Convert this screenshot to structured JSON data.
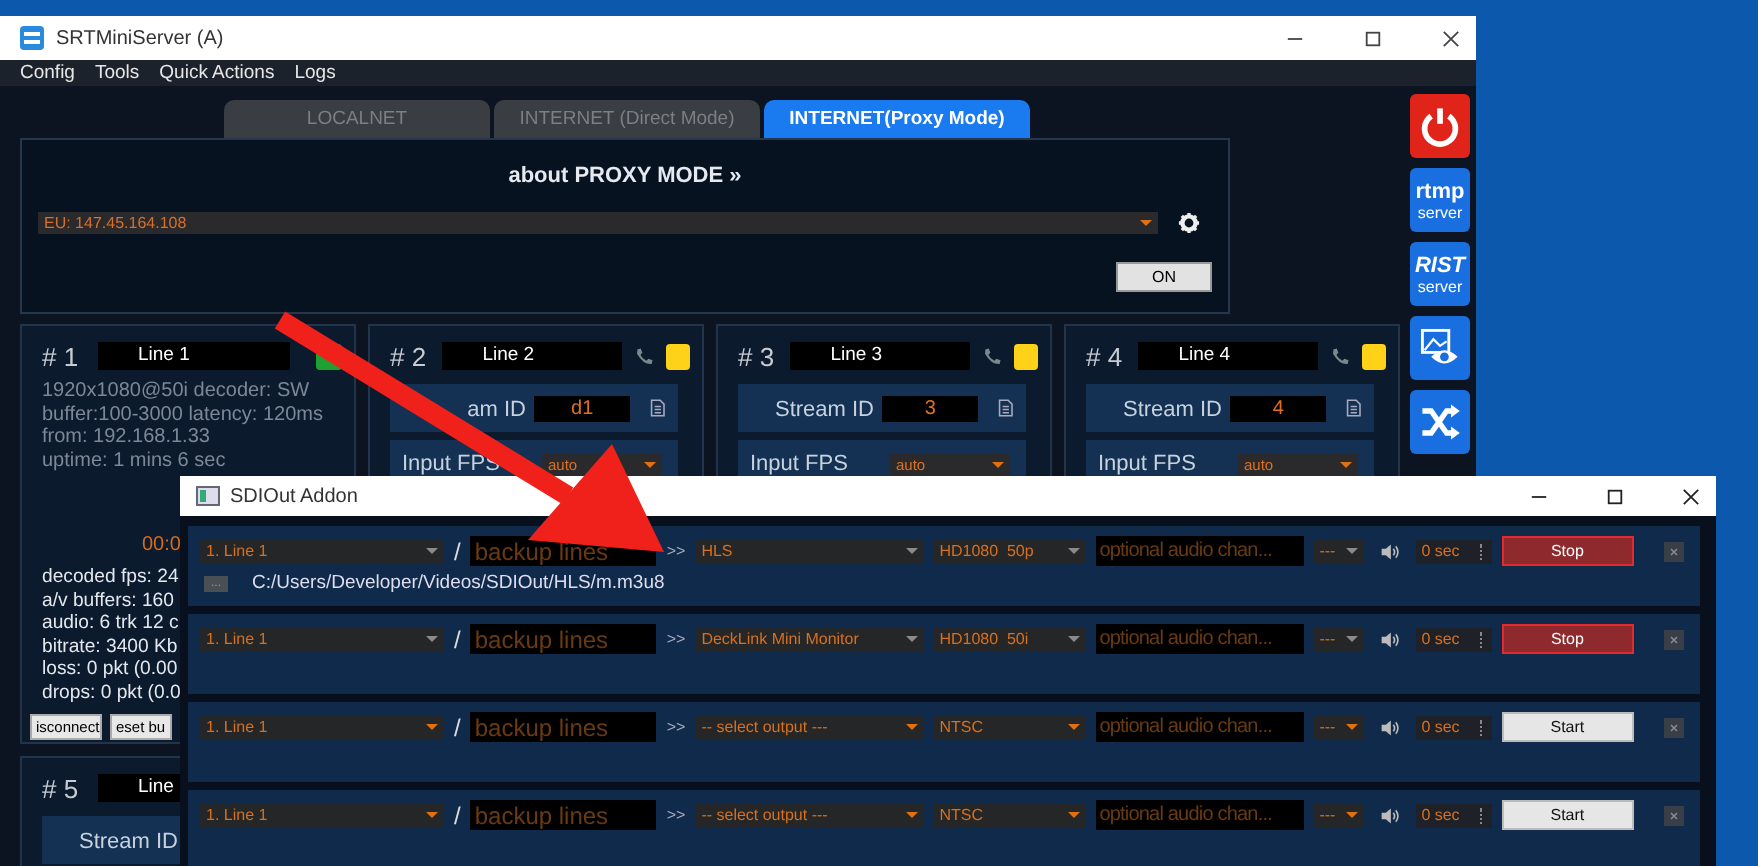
{
  "window": {
    "title": "SRTMiniServer (A)"
  },
  "menu": [
    "Config",
    "Tools",
    "Quick Actions",
    "Logs"
  ],
  "tabs": [
    {
      "label": "LOCALNET",
      "selected": false
    },
    {
      "label": "INTERNET (Direct Mode)",
      "selected": false
    },
    {
      "label": "INTERNET(Proxy Mode)",
      "selected": true
    }
  ],
  "proxy": {
    "title": "about PROXY MODE »",
    "server": "EU: 147.45.164.108",
    "toggle": "ON"
  },
  "lines": [
    {
      "kind": "status",
      "number": "# 1",
      "name": "Line 1",
      "color": "#1fa030",
      "info": [
        "1920x1080@50i decoder: SW",
        "buffer:100-3000 latency: 120ms",
        "from: 192.168.1.33",
        "uptime: 1 mins 6 sec"
      ],
      "timer": "00:0",
      "stats": [
        "decoded fps: 24",
        "a/v buffers: 160",
        "audio: 6 trk 12 c",
        "bitrate: 3400 Kb",
        "loss: 0 pkt (0.00",
        "drops: 0 pkt (0.0"
      ],
      "buttons": [
        "isconnect",
        "eset bu"
      ]
    },
    {
      "kind": "config",
      "number": "# 2",
      "name": "Line 2",
      "color": "#ffd21a",
      "stream_label": "am ID",
      "stream_id": "d1",
      "fps_label": "Input FPS",
      "fps": "auto"
    },
    {
      "kind": "config",
      "number": "# 3",
      "name": "Line 3",
      "color": "#ffd21a",
      "stream_label": "Stream ID",
      "stream_id": "3",
      "fps_label": "Input FPS",
      "fps": "auto"
    },
    {
      "kind": "config",
      "number": "# 4",
      "name": "Line 4",
      "color": "#ffd21a",
      "stream_label": "Stream ID",
      "stream_id": "4",
      "fps_label": "Input FPS",
      "fps": "auto"
    },
    {
      "kind": "config",
      "number": "# 5",
      "name": "Line",
      "stream_label": "Stream ID"
    }
  ],
  "side_buttons": [
    {
      "kind": "power"
    },
    {
      "kind": "text",
      "label": "rtmp",
      "sub": "server"
    },
    {
      "kind": "text",
      "label": "RIST",
      "sub": "server"
    },
    {
      "kind": "preview"
    },
    {
      "kind": "shuffle"
    }
  ],
  "sdi": {
    "title": "SDIOut Addon",
    "rows": [
      {
        "source": "1. Line 1",
        "slash": "/",
        "backup_placeholder": "backup lines",
        "arrow": ">>",
        "output": "HLS",
        "format": "HD1080  50p",
        "audio_placeholder": "optional audio chan...",
        "channels": "---",
        "delay": "0 sec",
        "button": "Stop",
        "running": true,
        "browse": "...",
        "path": "C:/Users/Developer/Videos/SDIOut/HLS/m.m3u8"
      },
      {
        "source": "1. Line 1",
        "slash": "/",
        "backup_placeholder": "backup lines",
        "arrow": ">>",
        "output": "DeckLink Mini Monitor",
        "format": "HD1080  50i",
        "audio_placeholder": "optional audio chan...",
        "channels": "---",
        "delay": "0 sec",
        "button": "Stop",
        "running": true
      },
      {
        "source": "1. Line 1",
        "slash": "/",
        "backup_placeholder": "backup lines",
        "arrow": ">>",
        "output": "-- select output ---",
        "format": "NTSC",
        "audio_placeholder": "optional audio chan...",
        "channels": "---",
        "delay": "0 sec",
        "button": "Start",
        "running": false
      },
      {
        "source": "1. Line 1",
        "slash": "/",
        "backup_placeholder": "backup lines",
        "arrow": ">>",
        "output": "-- select output ---",
        "format": "NTSC",
        "audio_placeholder": "optional audio chan...",
        "channels": "---",
        "delay": "0 sec",
        "button": "Start",
        "running": false
      }
    ]
  }
}
